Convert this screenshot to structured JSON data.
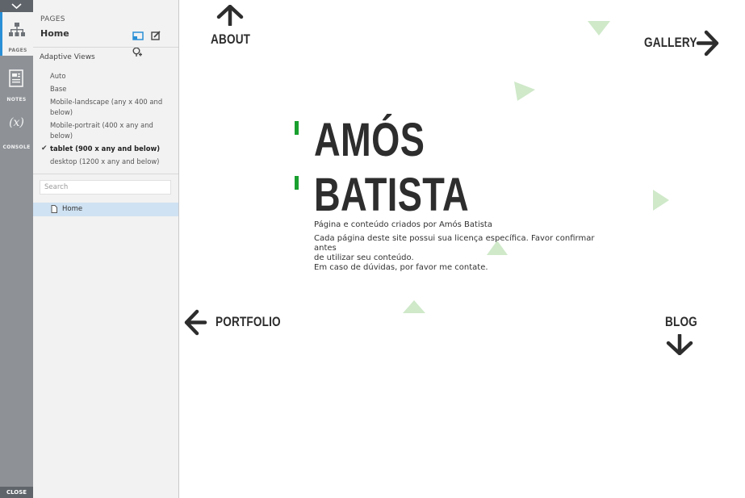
{
  "rail": {
    "items": [
      {
        "label": "PAGES",
        "icon": "sitemap-icon"
      },
      {
        "label": "NOTES",
        "icon": "notes-icon"
      },
      {
        "label": "CONSOLE",
        "icon": "variable-x-icon",
        "glyph": "(x)"
      }
    ],
    "close_label": "CLOSE",
    "accent": "#2a8fd6"
  },
  "panel": {
    "section_label": "PAGES",
    "current_page": "Home",
    "adaptive_title": "Adaptive Views",
    "views": [
      {
        "label": "Auto"
      },
      {
        "label": "Base"
      },
      {
        "label": "Mobile-landscape (any x 400 and below)"
      },
      {
        "label": "Mobile-portrait (400 x any and below)"
      },
      {
        "label": "tablet (900 x any and below)",
        "selected": true
      },
      {
        "label": "desktop (1200 x any and below)"
      }
    ],
    "search_placeholder": "Search",
    "tree": [
      {
        "label": "Home",
        "selected": true
      }
    ]
  },
  "canvas": {
    "nav": {
      "about": "ABOUT",
      "gallery": "GALLERY",
      "portfolio": "PORTFOLIO",
      "blog": "BLOG"
    },
    "title_line1": "AMÓS",
    "title_line2": "BATISTA",
    "credit": "Página e conteúdo criados por Amós Batista",
    "license_line1": "Cada página deste site possui sua licença específica. Favor confirmar",
    "license_line2": "antes",
    "license_line3": "de utilizar seu conteúdo.",
    "license_line4": "Em caso de dúvidas, por favor me contate.",
    "colors": {
      "accent_green": "#19a02f",
      "triangle": "#cfe9c9",
      "text_dark": "#2d2d2d"
    }
  }
}
